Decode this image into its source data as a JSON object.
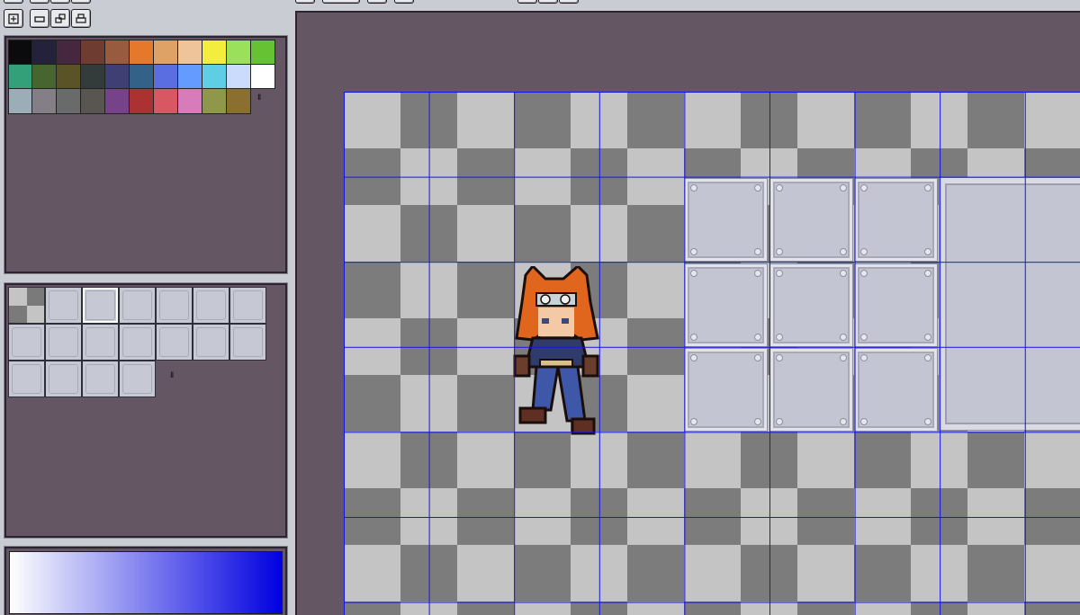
{
  "toolbar": {
    "buttons": [
      {
        "name": "grid-toggle-icon"
      },
      {
        "name": "single-layer-icon"
      },
      {
        "name": "overlay-layers-icon"
      },
      {
        "name": "print-layer-icon"
      }
    ]
  },
  "palette": {
    "handle_label": "II",
    "rows": [
      [
        "#0b0b0e",
        "#24223a",
        "#45283f",
        "#6e3c31",
        "#985b3f",
        "#e5782b",
        "#dfa266",
        "#f0c49b",
        "#f3ed3e",
        "#9ae05b",
        "#66c232"
      ],
      [
        "#33a07a",
        "#47662f",
        "#5a5327",
        "#343b3b",
        "#3f3f74",
        "#346187",
        "#5b6ee1",
        "#639bff",
        "#5fcde4",
        "#cbdbfc",
        "#ffffff"
      ],
      [
        "#9badb7",
        "#847e87",
        "#696a6a",
        "#595652",
        "#76428a",
        "#ac3232",
        "#d95763",
        "#d77bba",
        "#8f974a",
        "#8a6f30"
      ]
    ]
  },
  "tileset": {
    "handle_label": "II",
    "tiles": 18
  },
  "colors": {
    "panel_bg": "#645663",
    "grid_line": "#1414e6",
    "gradient_end": "#0000e0"
  }
}
